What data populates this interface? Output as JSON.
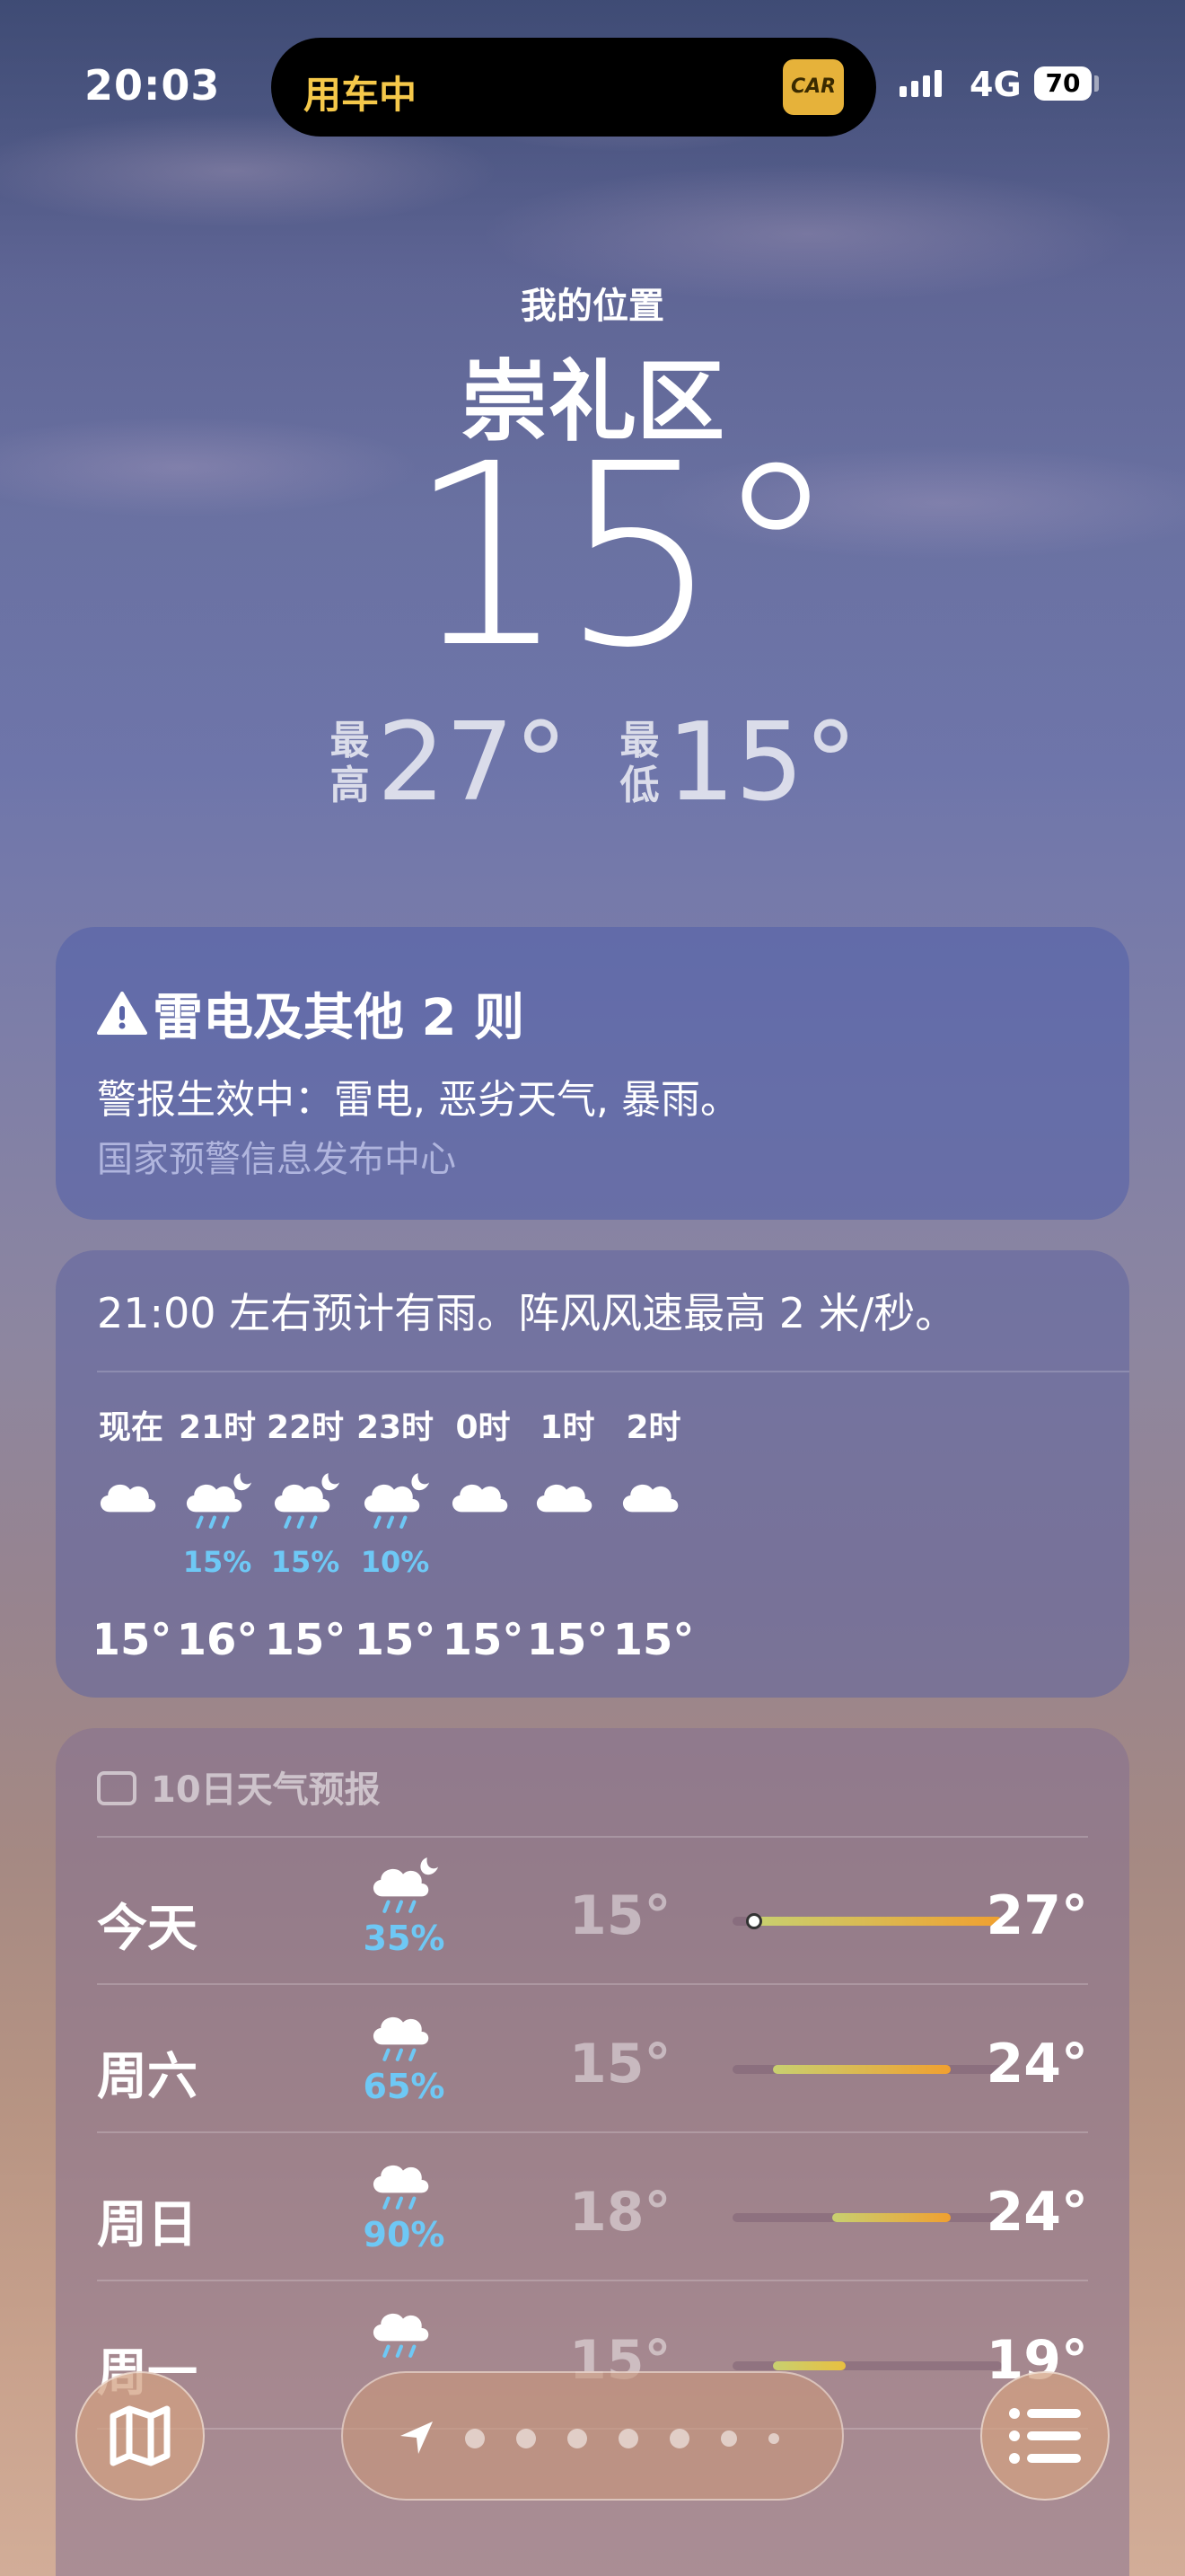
{
  "status_bar": {
    "time": "20:03",
    "island_label": "用车中",
    "island_badge": "CAR",
    "network": "4G",
    "battery": "70"
  },
  "header": {
    "location_label": "我的位置",
    "city": "崇礼区",
    "current_temp": "15°",
    "high_label": "最高",
    "high": "27°",
    "low_label": "最低",
    "low": "15°"
  },
  "alert": {
    "title": "雷电及其他 2 则",
    "body": "警报生效中：雷电, 恶劣天气, 暴雨。",
    "source": "国家预警信息发布中心"
  },
  "hourly": {
    "summary": "21:00 左右预计有雨。阵风风速最高 2 米/秒。",
    "items": [
      {
        "hour": "现在",
        "icon": "cloud-icon",
        "precip": "",
        "temp": "15°"
      },
      {
        "hour": "21时",
        "icon": "cloud-moon-rain-icon",
        "precip": "15%",
        "temp": "16°"
      },
      {
        "hour": "22时",
        "icon": "cloud-moon-rain-icon",
        "precip": "15%",
        "temp": "15°"
      },
      {
        "hour": "23时",
        "icon": "cloud-moon-rain-icon",
        "precip": "10%",
        "temp": "15°"
      },
      {
        "hour": "0时",
        "icon": "cloud-icon",
        "precip": "",
        "temp": "15°"
      },
      {
        "hour": "1时",
        "icon": "cloud-icon",
        "precip": "",
        "temp": "15°"
      },
      {
        "hour": "2时",
        "icon": "cloud-icon",
        "precip": "",
        "temp": "15°"
      }
    ]
  },
  "daily": {
    "heading": "10日天气预报",
    "items": [
      {
        "day": "今天",
        "icon": "cloud-moon-rain-icon",
        "precip": "35%",
        "low": "15°",
        "high": "27°",
        "range_start": 0.08,
        "range_end": 1.0,
        "current": 0.08
      },
      {
        "day": "周六",
        "icon": "cloud-rain-icon",
        "precip": "65%",
        "low": "15°",
        "high": "24°",
        "range_start": 0.15,
        "range_end": 0.81
      },
      {
        "day": "周日",
        "icon": "cloud-rain-icon",
        "precip": "90%",
        "low": "18°",
        "high": "24°",
        "range_start": 0.37,
        "range_end": 0.81
      },
      {
        "day": "周一",
        "icon": "cloud-rain-icon",
        "precip": "",
        "low": "15°",
        "high": "19°",
        "range_start": 0.15,
        "range_end": 0.42
      }
    ]
  },
  "colors": {
    "precip": "#6ec8f5",
    "island_text": "#f5c84a",
    "range_warm": "#f0a030",
    "range_mild": "#c8d070"
  }
}
